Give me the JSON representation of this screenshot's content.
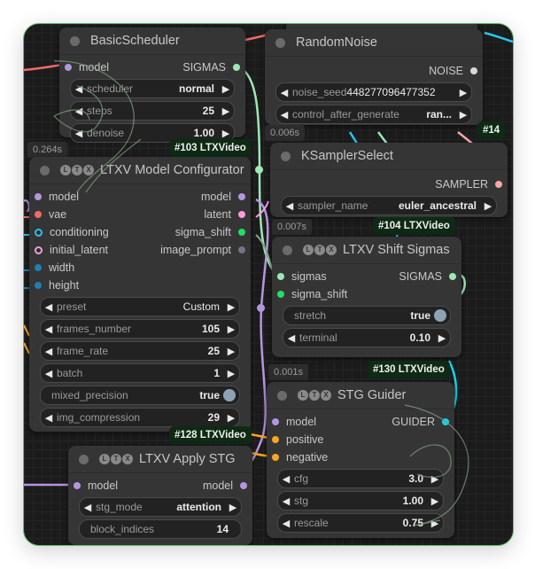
{
  "colors": {
    "model": "#b595e0",
    "vae": "#f06a6a",
    "conditioning": "#29c4ee",
    "latent": "#f59ce0",
    "int": "#1f7fb0",
    "sigmas": "#9ee8b8",
    "float": "#22dd66",
    "sampler": "#f3a8a8",
    "noise": "#d8d8d8",
    "guider": "#12d4e4",
    "image": "#7a7088",
    "positive": "#f7a623",
    "badge_bg": "#0e2a14",
    "canvas_border": "#5fbf6a"
  },
  "nodes": {
    "basic_scheduler": {
      "title": "BasicScheduler",
      "inputs": [
        {
          "label": "model"
        }
      ],
      "outputs": [
        {
          "label": "SIGMAS"
        }
      ],
      "widgets": [
        {
          "label": "scheduler",
          "value": "normal"
        },
        {
          "label": "steps",
          "value": "25"
        },
        {
          "label": "denoise",
          "value": "1.00"
        }
      ]
    },
    "random_noise": {
      "title": "RandomNoise",
      "outputs": [
        {
          "label": "NOISE"
        }
      ],
      "widgets": [
        {
          "label": "noise_seed",
          "value": "448277096477352"
        },
        {
          "label": "control_after_generate",
          "value": "ran..."
        }
      ],
      "timing": "0.006s",
      "badge": "#14"
    },
    "model_configurator": {
      "title": "LTXV Model Configurator",
      "timing": "0.264s",
      "badge": "#103 LTXVideo",
      "inputs": [
        {
          "label": "model"
        },
        {
          "label": "vae"
        },
        {
          "label": "conditioning"
        },
        {
          "label": "initial_latent"
        },
        {
          "label": "width"
        },
        {
          "label": "height"
        }
      ],
      "outputs": [
        {
          "label": "model"
        },
        {
          "label": "latent"
        },
        {
          "label": "sigma_shift"
        },
        {
          "label": "image_prompt"
        }
      ],
      "widgets": [
        {
          "label": "preset",
          "value": "Custom"
        },
        {
          "label": "frames_number",
          "value": "105"
        },
        {
          "label": "frame_rate",
          "value": "25"
        },
        {
          "label": "batch",
          "value": "1"
        },
        {
          "label": "mixed_precision",
          "value": "true"
        },
        {
          "label": "img_compression",
          "value": "29"
        }
      ]
    },
    "ksampler_select": {
      "title": "KSamplerSelect",
      "outputs": [
        {
          "label": "SAMPLER"
        }
      ],
      "widgets": [
        {
          "label": "sampler_name",
          "value": "euler_ancestral"
        }
      ],
      "timing": "0.007s",
      "badge": "#104 LTXVideo"
    },
    "shift_sigmas": {
      "title": "LTXV Shift Sigmas",
      "inputs": [
        {
          "label": "sigmas"
        },
        {
          "label": "sigma_shift"
        }
      ],
      "outputs": [
        {
          "label": "SIGMAS"
        }
      ],
      "widgets": [
        {
          "label": "stretch",
          "value": "true"
        },
        {
          "label": "terminal",
          "value": "0.10"
        }
      ],
      "timing": "0.001s",
      "badge": "#130 LTXVideo"
    },
    "stg_guider": {
      "title": "STG Guider",
      "inputs": [
        {
          "label": "model"
        },
        {
          "label": "positive"
        },
        {
          "label": "negative"
        }
      ],
      "outputs": [
        {
          "label": "GUIDER"
        }
      ],
      "widgets": [
        {
          "label": "cfg",
          "value": "3.0"
        },
        {
          "label": "stg",
          "value": "1.00"
        },
        {
          "label": "rescale",
          "value": "0.75"
        }
      ]
    },
    "apply_stg": {
      "title": "LTXV Apply STG",
      "badge": "#128 LTXVideo",
      "inputs": [
        {
          "label": "model"
        }
      ],
      "outputs": [
        {
          "label": "model"
        }
      ],
      "widgets": [
        {
          "label": "stg_mode",
          "value": "attention"
        },
        {
          "label": "block_indices",
          "value": "14"
        }
      ]
    }
  },
  "icons": {
    "arrow_left": "◀",
    "arrow_right": "▶",
    "ltx_logo": [
      "L",
      "T",
      "X"
    ]
  }
}
